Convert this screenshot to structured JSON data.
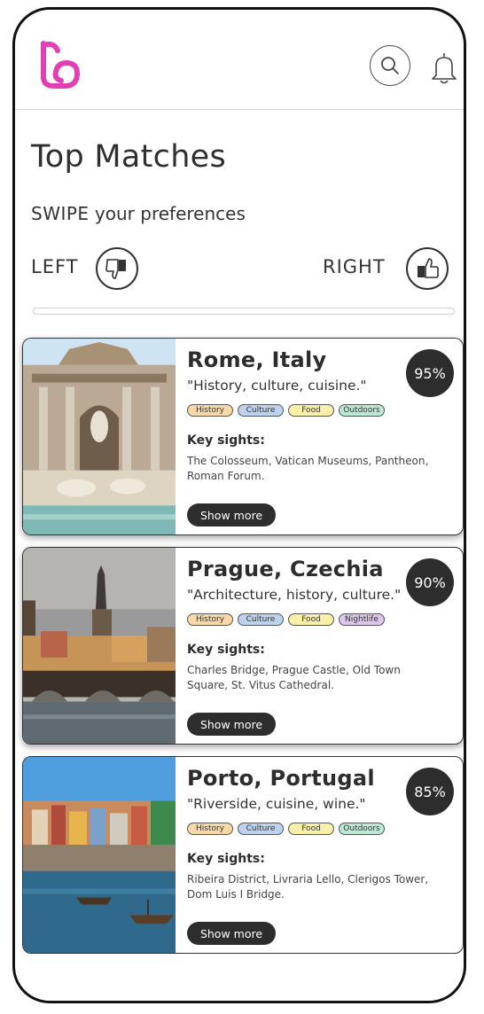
{
  "app": {
    "brand_color": "#e23fb4",
    "logo_icon": "b-heart-logo-icon"
  },
  "header": {
    "search_icon": "search-icon",
    "bell_icon": "bell-icon"
  },
  "page": {
    "title": "Top Matches",
    "swipe_bold": "SWIPE",
    "swipe_rest": " your preferences",
    "left_label": "LEFT",
    "right_label": "RIGHT",
    "progress": 0
  },
  "cards": [
    {
      "city": "Rome, Italy",
      "tagline": "\"History, culture, cuisine.\"",
      "match": "95%",
      "tags": [
        "History",
        "Culture",
        "Food",
        "Outdoors"
      ],
      "key_sights_label": "Key sights:",
      "key_sights": "The Colosseum, Vatican Museums, Pantheon, Roman Forum.",
      "button": "Show more"
    },
    {
      "city": "Prague, Czechia",
      "tagline": "\"Architecture, history, culture.\"",
      "match": "90%",
      "tags": [
        "History",
        "Culture",
        "Food",
        "Nightlife"
      ],
      "key_sights_label": "Key sights:",
      "key_sights": "Charles Bridge, Prague Castle, Old Town Square, St. Vitus Cathedral.",
      "button": "Show more"
    },
    {
      "city": "Porto, Portugal",
      "tagline": "\"Riverside, cuisine, wine.\"",
      "match": "85%",
      "tags": [
        "History",
        "Culture",
        "Food",
        "Outdoors"
      ],
      "key_sights_label": "Key sights:",
      "key_sights": "Ribeira District, Livraria Lello, Clerigos Tower, Dom Luis I Bridge.",
      "button": "Show more"
    }
  ]
}
